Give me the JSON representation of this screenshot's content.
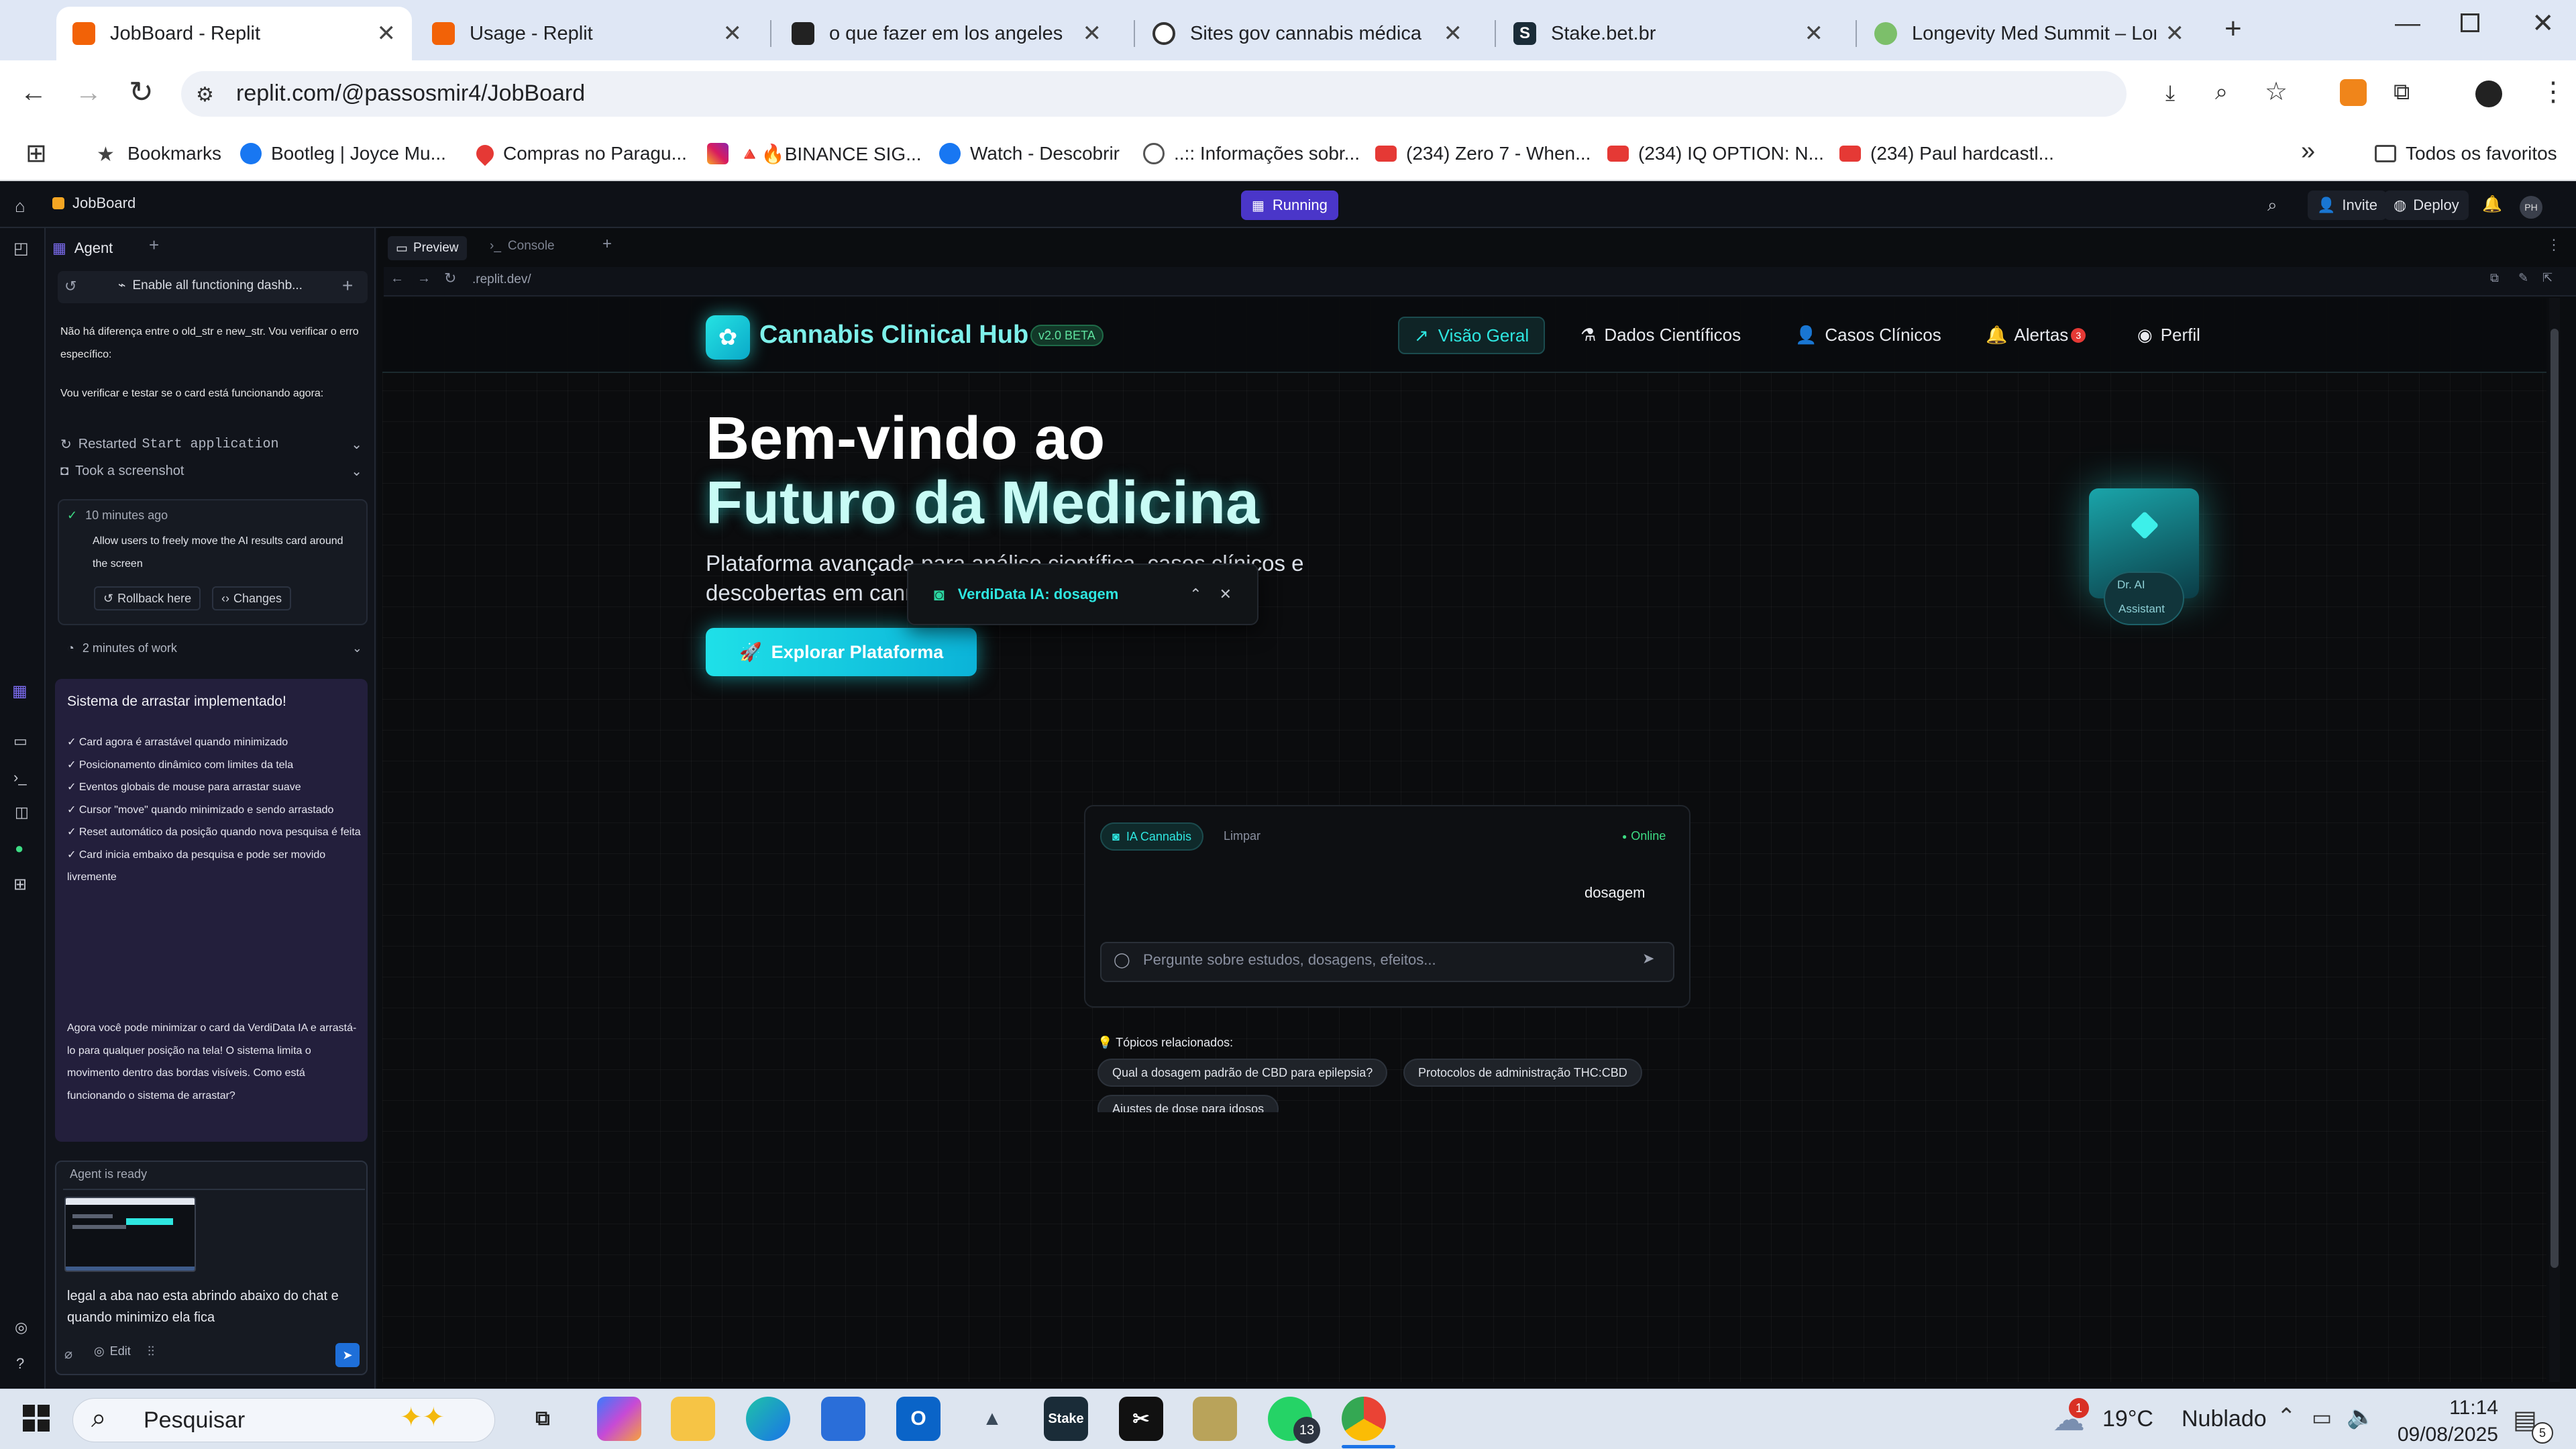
{
  "browser": {
    "tabs": [
      {
        "title": "JobBoard - Replit",
        "active": true
      },
      {
        "title": "Usage - Replit"
      },
      {
        "title": "o que fazer em los angeles"
      },
      {
        "title": "Sites gov cannabis médica"
      },
      {
        "title": "Stake.bet.br"
      },
      {
        "title": "Longevity Med Summit – Longe"
      }
    ],
    "url": "replit.com/@passosmir4/JobBoard",
    "bookmarks": [
      {
        "label": "Bookmarks",
        "icon": "star-icon"
      },
      {
        "label": "Bootleg | Joyce Mu...",
        "icon": "facebook-icon"
      },
      {
        "label": "Compras no Paragu...",
        "icon": "map-pin-icon"
      },
      {
        "label": "🔺🔥BINANCE SIG...",
        "icon": "instagram-icon"
      },
      {
        "label": "Watch - Descobrir",
        "icon": "facebook-icon"
      },
      {
        "label": "..:: Informações sobr...",
        "icon": "globe-icon"
      },
      {
        "label": "(234) Zero 7 - When...",
        "icon": "youtube-icon"
      },
      {
        "label": "(234) IQ OPTION: N...",
        "icon": "youtube-icon"
      },
      {
        "label": "(234) Paul hardcastl...",
        "icon": "youtube-icon"
      }
    ],
    "all_bookmarks": "Todos os favoritos"
  },
  "replit": {
    "repl_name": "JobBoard",
    "status": "Running",
    "invite": "Invite",
    "deploy": "Deploy",
    "avatar": "PH",
    "agent_tab": "Agent",
    "preview_tab": "Preview",
    "console_tab": "Console",
    "preview_url": ".replit.dev/",
    "thread_title": "Enable all functioning dashb...",
    "messages": {
      "m1": "Não há diferença entre o old_str e new_str. Vou verificar o erro específico:",
      "m2": "Vou verificar e testar se o card está funcionando agora:",
      "restarted_label": "Restarted",
      "restarted_cmd": "Start application",
      "screenshot": "Took a screenshot",
      "checkpoint_time": "10 minutes ago",
      "checkpoint_text": "Allow users to freely move the AI results card around the screen",
      "rollback": "Rollback here",
      "changes": "Changes",
      "work": "2 minutes of work",
      "summary_title": "Sistema de arrastar implementado!",
      "summary_items": [
        "✓ Card agora é arrastável quando minimizado",
        "✓ Posicionamento dinâmico com limites da tela",
        "✓ Eventos globais de mouse para arrastar suave",
        "✓ Cursor \"move\" quando minimizado e sendo arrastado",
        "✓ Reset automático da posição quando nova pesquisa é feita",
        "✓ Card inicia embaixo da pesquisa e pode ser movido livremente"
      ],
      "summary_end": "Agora você pode minimizar o card da VerdiData IA e arrastá-lo para qualquer posição na tela! O sistema limita o movimento dentro das bordas visíveis. Como está funcionando o sistema de arrastar?"
    },
    "agent_ready": "Agent is ready",
    "input_text": "legal a aba nao esta abrindo abaixo do chat e quando minimizo ela fica",
    "edit": "Edit"
  },
  "site": {
    "brand": "Cannabis Clinical Hub",
    "version": "v2.0 BETA",
    "nav": [
      {
        "label": "Visão Geral",
        "icon": "chart-icon",
        "active": true
      },
      {
        "label": "Dados Científicos",
        "icon": "flask-icon"
      },
      {
        "label": "Casos Clínicos",
        "icon": "user-icon"
      },
      {
        "label": "Alertas",
        "icon": "bell-icon",
        "badge": "3"
      },
      {
        "label": "Perfil",
        "icon": "profile-icon"
      }
    ],
    "hero_line1": "Bem-vindo ao",
    "hero_line2": "Futuro da Medicina",
    "hero_sub1": "Plataforma avançada para análise científica, casos clínicos e",
    "hero_sub2": "descobertas em cannabis medicinal",
    "cta": "Explorar Plataforma",
    "floating_card_title": "VerdiData IA: dosagem",
    "assistant_label1": "Dr. AI",
    "assistant_label2": "Assistant",
    "chat": {
      "tab": "IA Cannabis",
      "clear": "Limpar",
      "status": "Online",
      "user_message": "dosagem",
      "placeholder": "Pergunte sobre estudos, dosagens, efeitos..."
    },
    "topics_title": "💡 Tópicos relacionados:",
    "topics": [
      "Qual a dosagem padrão de CBD para epilepsia?",
      "Protocolos de administração THC:CBD",
      "Ajustes de dose para idosos"
    ]
  },
  "taskbar": {
    "search": "Pesquisar",
    "weather_temp": "19°C",
    "weather_text": "Nublado",
    "time": "11:14",
    "date": "09/08/2025",
    "whatsapp_badge": "13",
    "weather_badge": "1",
    "notif_badge": "5"
  },
  "colors": {
    "accent": "#2ee6e0",
    "replit_purple": "#4a36c9",
    "success": "#3ddc84"
  }
}
